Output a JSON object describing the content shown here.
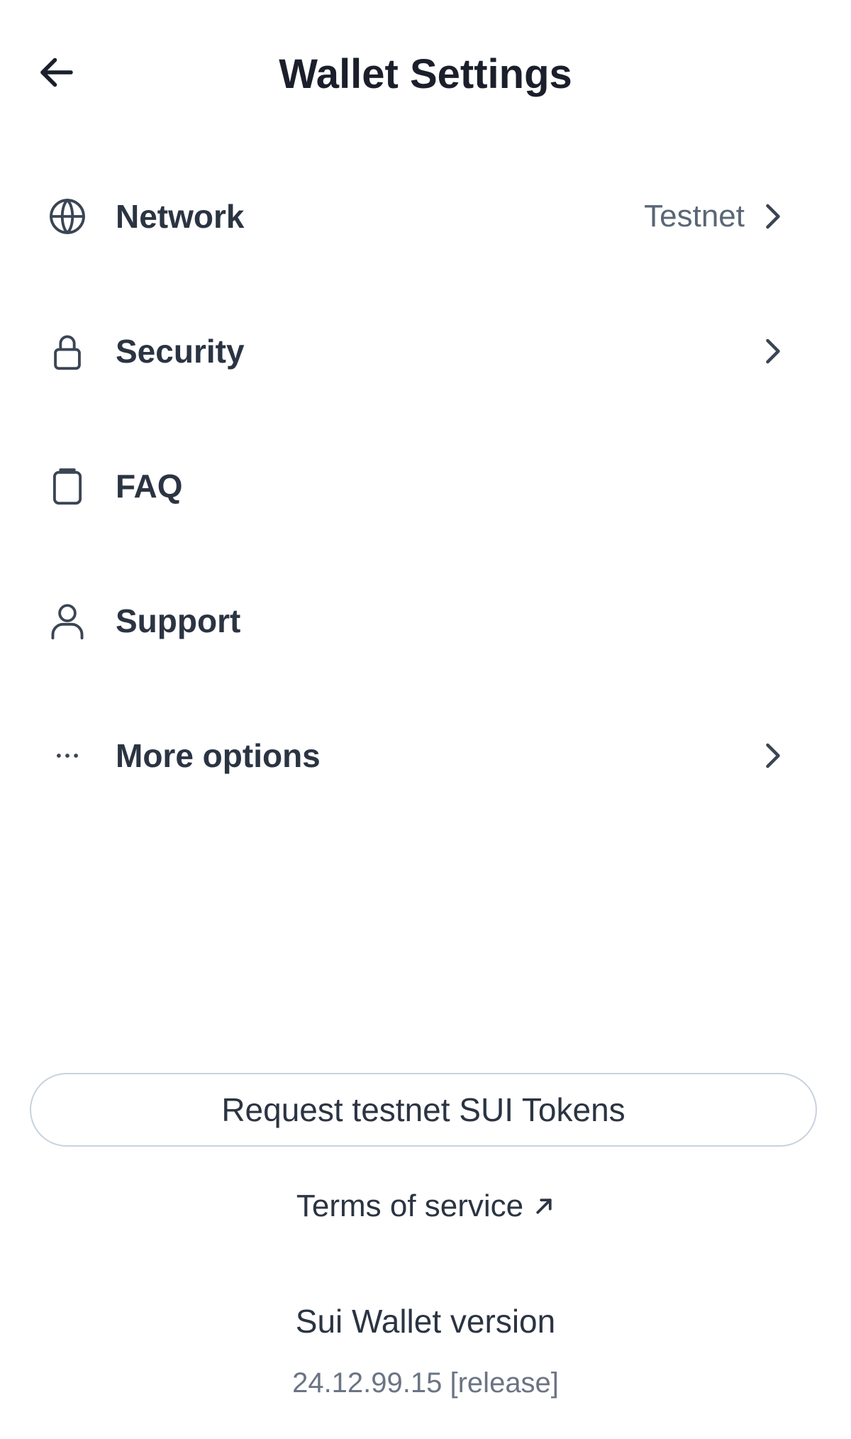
{
  "header": {
    "title": "Wallet Settings",
    "back_icon": "arrow-left-icon"
  },
  "menu": {
    "items": [
      {
        "id": "network",
        "label": "Network",
        "value": "Testnet",
        "icon": "globe-icon",
        "has_chevron": true
      },
      {
        "id": "security",
        "label": "Security",
        "value": "",
        "icon": "lock-icon",
        "has_chevron": true
      },
      {
        "id": "faq",
        "label": "FAQ",
        "value": "",
        "icon": "clipboard-icon",
        "has_chevron": false
      },
      {
        "id": "support",
        "label": "Support",
        "value": "",
        "icon": "user-icon",
        "has_chevron": false
      },
      {
        "id": "more-options",
        "label": "More options",
        "value": "",
        "icon": "ellipsis-icon",
        "has_chevron": true
      }
    ]
  },
  "footer": {
    "request_button_label": "Request testnet SUI Tokens",
    "terms_label": "Terms of service",
    "terms_icon": "external-link-icon",
    "version_title": "Sui Wallet version",
    "version_number": "24.12.99.15 [release]"
  },
  "colors": {
    "text_primary": "#2b3442",
    "text_secondary": "#5b6676",
    "icon_color": "#3b4554",
    "button_border": "#c9d2de"
  }
}
